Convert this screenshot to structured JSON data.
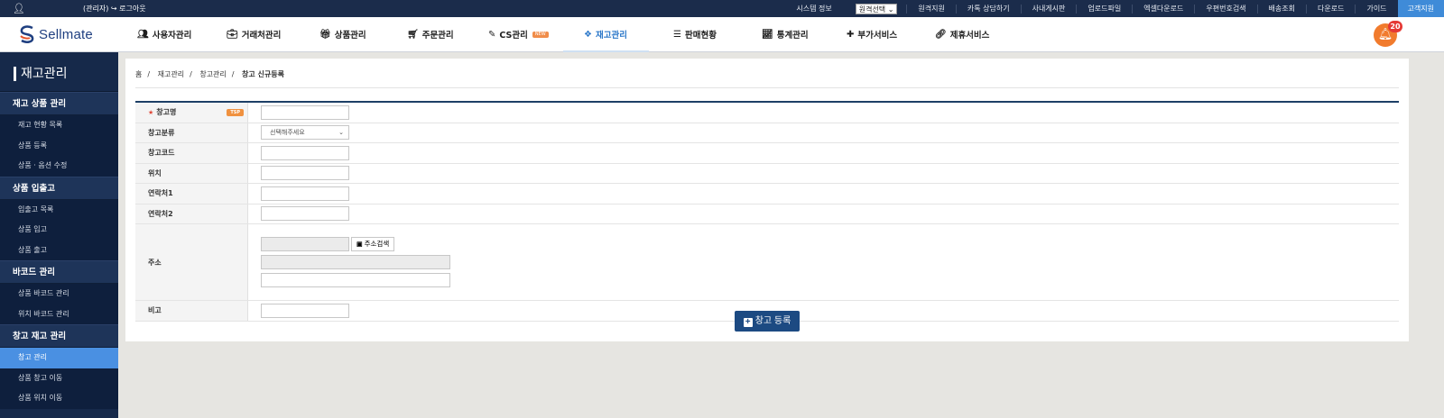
{
  "topbar": {
    "user_icon": "user-icon",
    "admin_text": "(관리자) ↪ 로그아웃",
    "links": [
      "시스템 정보"
    ],
    "remote_select": "원격선택",
    "links2": [
      "원격지원",
      "카톡 상담하기",
      "사내게시판",
      "업로드파일",
      "엑셀다운로드",
      "우편번호검색",
      "배송조회",
      "다운로드",
      "가이드"
    ],
    "customer_support": "고객지원"
  },
  "logo": {
    "text": "Sellmate"
  },
  "menu": {
    "items": [
      {
        "label": "사용자관리",
        "icon": "users-icon"
      },
      {
        "label": "거래처관리",
        "icon": "briefcase-icon"
      },
      {
        "label": "상품관리",
        "icon": "gift-icon"
      },
      {
        "label": "주문관리",
        "icon": "cart-icon"
      },
      {
        "label": "CS관리",
        "icon": "edit-icon",
        "badge": "NEW"
      },
      {
        "label": "재고관리",
        "icon": "cubes-icon"
      },
      {
        "label": "판매현황",
        "icon": "list-icon"
      },
      {
        "label": "통계관리",
        "icon": "chart-icon"
      },
      {
        "label": "부가서비스",
        "icon": "plus-icon"
      },
      {
        "label": "제휴서비스",
        "icon": "link-icon"
      }
    ],
    "notifications": "20"
  },
  "sidebar": {
    "title": "재고관리",
    "groups": [
      {
        "label": "재고 상품 관리",
        "items": [
          "재고 현황 목록",
          "상품 등록",
          "상품 · 옵션 수정"
        ]
      },
      {
        "label": "상품 입출고",
        "items": [
          "입출고 목록",
          "상품 입고",
          "상품 출고"
        ]
      },
      {
        "label": "바코드 관리",
        "items": [
          "상품 바코드 관리",
          "위치 바코드 관리"
        ]
      },
      {
        "label": "창고 재고 관리",
        "items": [
          "창고 관리",
          "상품 창고 이동",
          "상품 위치 이동"
        ]
      }
    ]
  },
  "breadcrumb": {
    "home": "홈",
    "level1": "재고관리",
    "level2": "창고관리",
    "current": "창고 신규등록"
  },
  "form": {
    "name_label": "창고명",
    "tsp_badge": "TSP",
    "category_label": "창고분류",
    "category_placeholder": "선택해주세요",
    "code_label": "창고코드",
    "location_label": "위치",
    "contact1_label": "연락처1",
    "contact2_label": "연락처2",
    "address_label": "주소",
    "address_search": "주소검색",
    "memo_label": "비고",
    "submit_label": "창고 등록"
  }
}
